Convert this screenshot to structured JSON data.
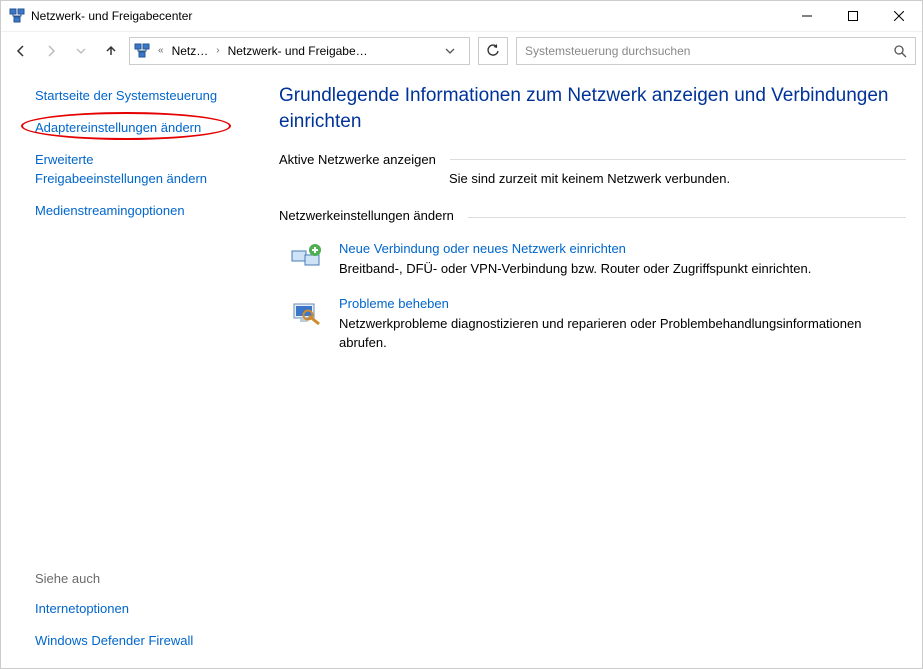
{
  "window": {
    "title": "Netzwerk- und Freigabecenter"
  },
  "breadcrumb": {
    "item1": "Netz…",
    "item2": "Netzwerk- und Freigabe…"
  },
  "search": {
    "placeholder": "Systemsteuerung durchsuchen"
  },
  "sidebar": {
    "home": "Startseite der Systemsteuerung",
    "adapter": "Adaptereinstellungen ändern",
    "sharing1": "Erweiterte",
    "sharing2": "Freigabeeinstellungen ändern",
    "media": "Medienstreamingoptionen",
    "see_also_label": "Siehe auch",
    "internet_options": "Internetoptionen",
    "firewall": "Windows Defender Firewall"
  },
  "main": {
    "heading": "Grundlegende Informationen zum Netzwerk anzeigen und Verbindungen einrichten",
    "active_label": "Aktive Netzwerke anzeigen",
    "active_status": "Sie sind zurzeit mit keinem Netzwerk verbunden.",
    "change_label": "Netzwerkeinstellungen ändern",
    "task1": {
      "title": "Neue Verbindung oder neues Netzwerk einrichten",
      "desc": "Breitband-, DFÜ- oder VPN-Verbindung bzw. Router oder Zugriffspunkt einrichten."
    },
    "task2": {
      "title": "Probleme beheben",
      "desc": "Netzwerkprobleme diagnostizieren und reparieren oder Problembehandlungsinformationen abrufen."
    }
  }
}
